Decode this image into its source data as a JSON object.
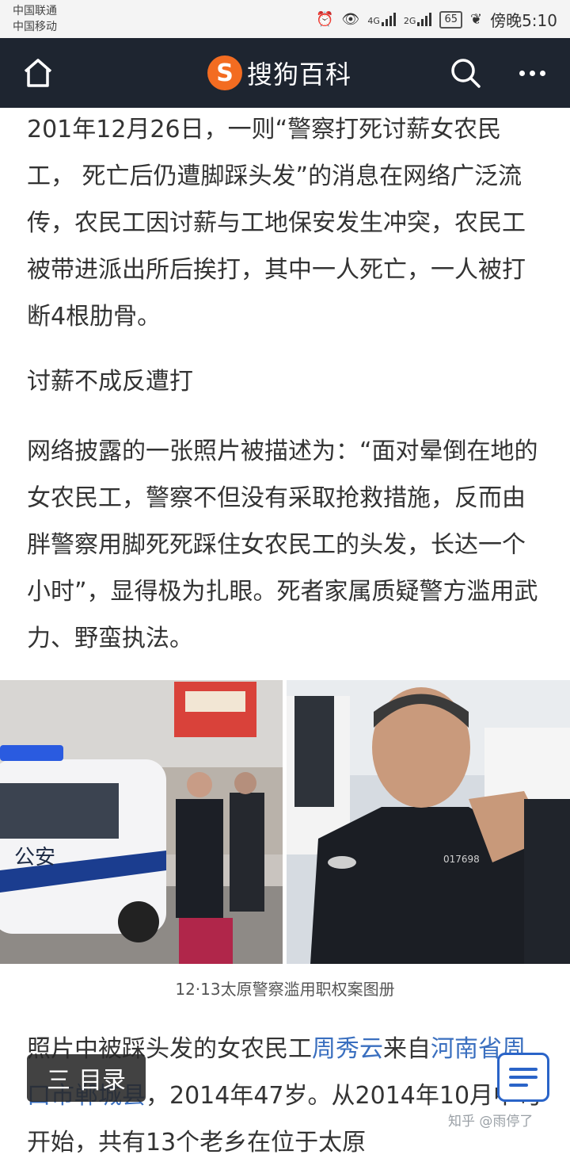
{
  "status_bar": {
    "carrier1": "中国联通",
    "carrier2": "中国移动",
    "net1": "4G",
    "net2": "2G",
    "battery": "65",
    "time": "傍晚5:10"
  },
  "header": {
    "logo_mark": "S",
    "logo_text": "搜狗百科"
  },
  "article": {
    "p1": "201年12月26日，一则“警察打死讨薪女农民工， 死亡后仍遭脚踩头发”的消息在网络广泛流传，农民工因讨薪与工地保安发生冲突，农民工被带进派出所后挨打，其中一人死亡，一人被打断4根肋骨。",
    "heading": "讨薪不成反遭打",
    "p2": "网络披露的一张照片被描述为：“面对晕倒在地的女农民工，警察不但没有采取抢救措施，反而由胖警察用脚死死踩住女农民工的头发，长达一个小时”，显得极为扎眼。死者家属质疑警方滥用武力、野蛮执法。",
    "photo_left_car_text": "公安",
    "photo_right_badge": "017698",
    "caption": "12·13太原警察滥用职权案图册",
    "p3_a": "照片中被踩头发的女农民工",
    "p3_link1": "周秀云",
    "p3_b": "来自",
    "p3_link2": "河南省周口市郸城县",
    "p3_c": "，2014年47岁。从2014年10月中旬开始，共有13个老乡在位于太原"
  },
  "toc_button": {
    "icon": "三",
    "label": "目录"
  },
  "watermark": "知乎 @雨停了",
  "colors": {
    "header_bg": "#1e2530",
    "logo_orange": "#f36c21",
    "link": "#3a6fbf",
    "float_border": "#2a64c8"
  }
}
